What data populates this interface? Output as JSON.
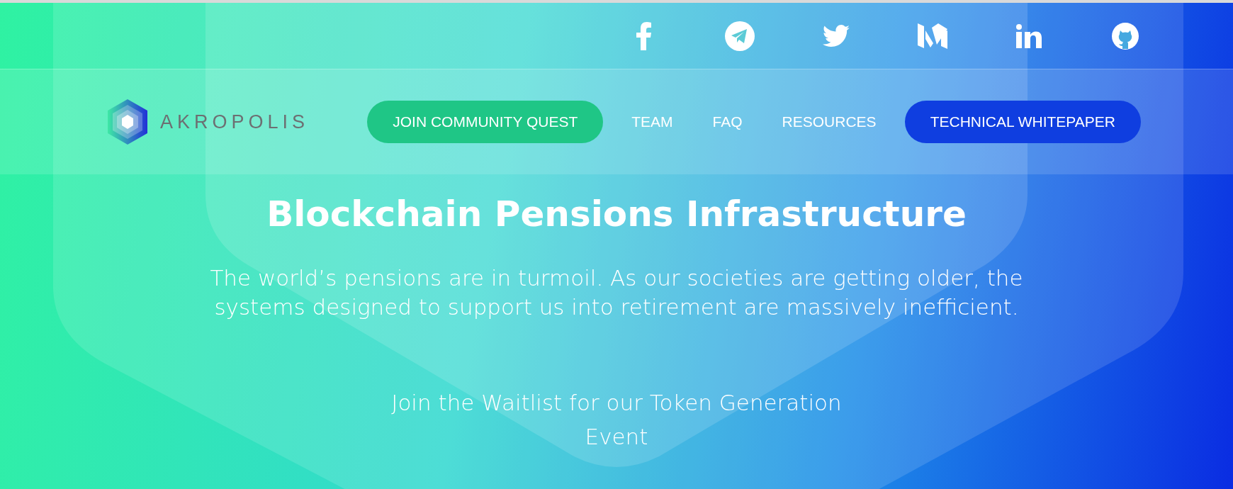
{
  "logo": {
    "text": "AKROPOLIS"
  },
  "nav": [
    {
      "label": "JOIN COMMUNITY QUEST",
      "kind": "primary"
    },
    {
      "label": "TEAM",
      "kind": "link"
    },
    {
      "label": "FAQ",
      "kind": "link"
    },
    {
      "label": "RESOURCES",
      "kind": "link"
    },
    {
      "label": "TECHNICAL WHITEPAPER",
      "kind": "secondary"
    }
  ],
  "hero": {
    "title": "Blockchain Pensions Infrastructure",
    "text": "The world’s pensions are in turmoil. As our societies are getting older, the systems designed to support us into retirement are massively inefficient.",
    "waitlist": "Join the Waitlist for our Token Generation Event"
  }
}
